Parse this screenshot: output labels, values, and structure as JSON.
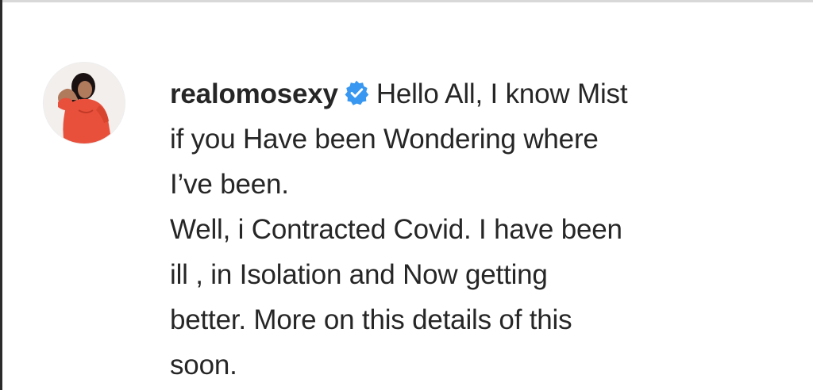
{
  "comment": {
    "username": "realomosexy",
    "verified_icon": "verified-badge-icon",
    "verified_color": "#3897f0",
    "avatar_icon": "profile-avatar-icon",
    "lines": [
      "Hello All, I know Mist",
      "if you Have been Wondering where",
      "I’ve been.",
      "Well, i Contracted Covid. I have been",
      "ill , in Isolation and Now getting",
      "better. More on this details of this",
      "soon."
    ]
  }
}
